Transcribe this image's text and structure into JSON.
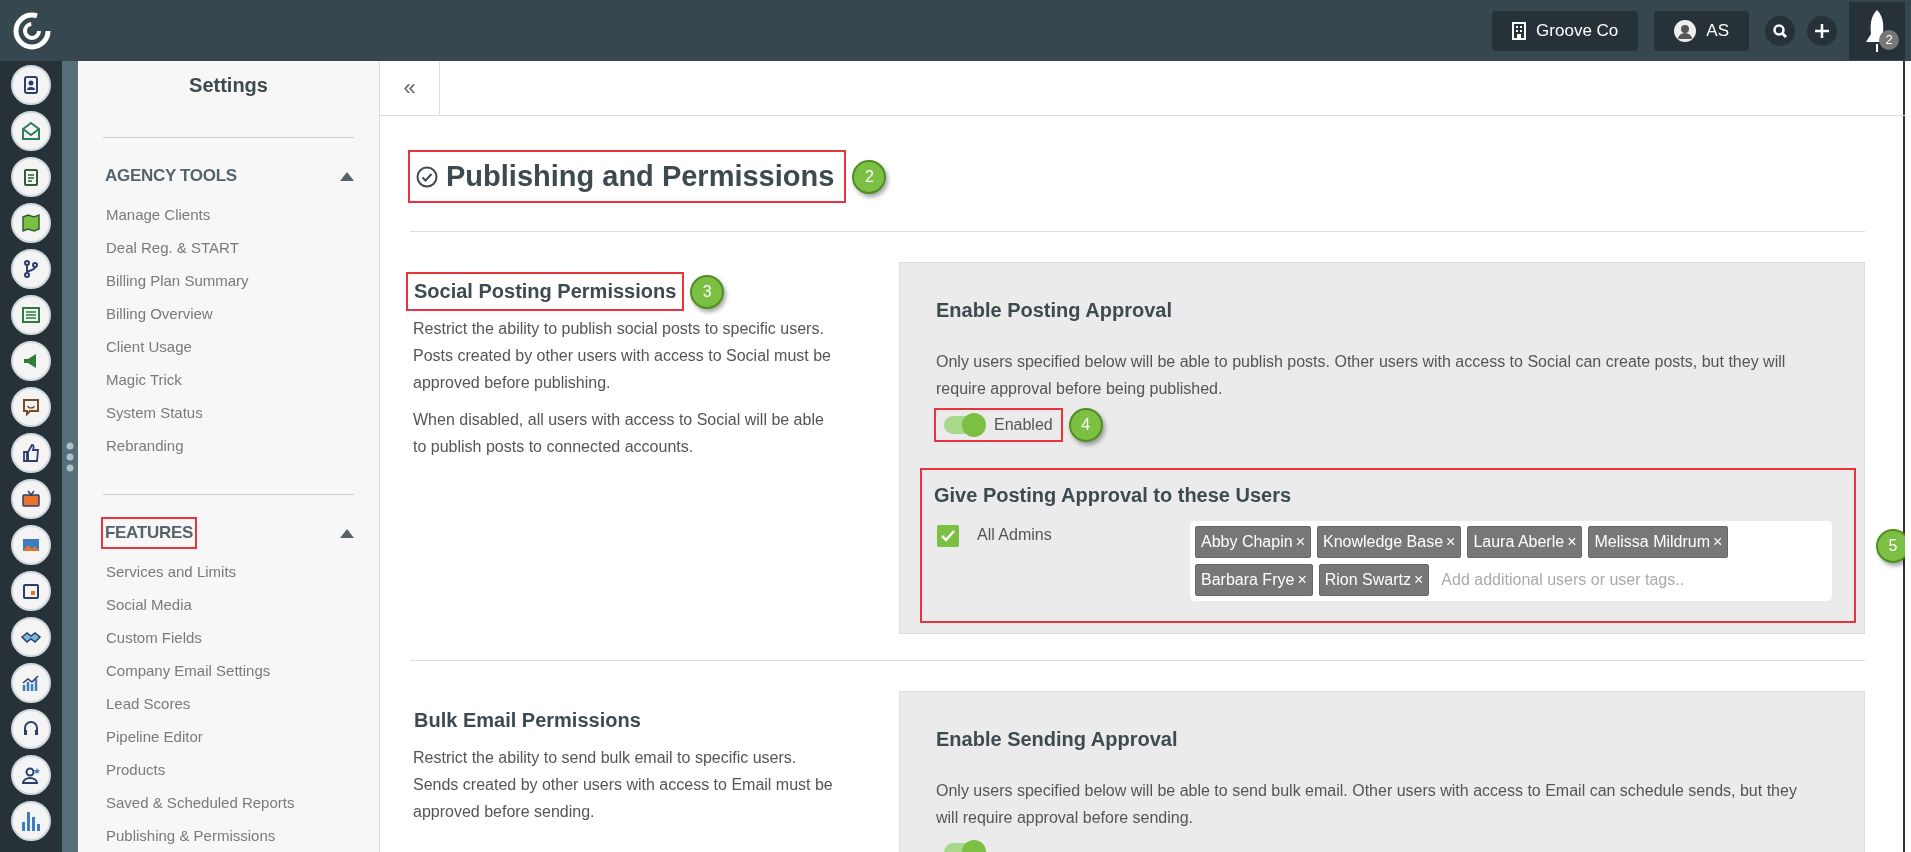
{
  "top_bar": {
    "company": "Groove Co",
    "user_initials": "AS",
    "notification_count": "2"
  },
  "sidebar": {
    "title": "Settings",
    "sections": [
      {
        "title": "AGENCY TOOLS",
        "expanded": true,
        "highlighted": false,
        "items": [
          "Manage Clients",
          "Deal Reg. & START",
          "Billing Plan Summary",
          "Billing Overview",
          "Client Usage",
          "Magic Trick",
          "System Status",
          "Rebranding"
        ]
      },
      {
        "title": "FEATURES",
        "expanded": true,
        "highlighted": true,
        "items": [
          "Services and Limits",
          "Social Media",
          "Custom Fields",
          "Company Email Settings",
          "Lead Scores",
          "Pipeline Editor",
          "Products",
          "Saved & Scheduled Reports",
          "Publishing & Permissions"
        ]
      }
    ]
  },
  "content": {
    "collapse_button": "«",
    "title": "Publishing and Permissions",
    "highlighted": true,
    "callout": "2",
    "sections": [
      {
        "title": "Social Posting Permissions",
        "highlighted": true,
        "callout": "3",
        "paragraphs": [
          "Restrict the ability to publish social posts to specific users. Posts created by other users with access to Social must be approved before publishing.",
          "When disabled, all users with access to Social will be able to publish posts to connected accounts."
        ],
        "panel": {
          "title": "Enable Posting Approval",
          "description": "Only users specified below will be able to publish posts. Other users with access to Social can create posts, but they will require approval before being published.",
          "toggle": {
            "label": "Enabled",
            "on": true,
            "highlighted": true,
            "callout": "4"
          },
          "users": {
            "title": "Give Posting Approval to these Users",
            "highlighted": true,
            "callout": "5",
            "checkbox": {
              "label": "All Admins",
              "checked": true
            },
            "tags": [
              {
                "name": "Abby Chapin",
                "remove": "×"
              },
              {
                "name": "Knowledge Base",
                "remove": "×"
              },
              {
                "name": "Laura Aberle",
                "remove": "×"
              },
              {
                "name": "Melissa Mildrum",
                "remove": "×"
              },
              {
                "name": "Barbara Frye",
                "remove": "×"
              },
              {
                "name": "Rion Swartz",
                "remove": "×"
              }
            ],
            "placeholder": "Add additional users or user tags.."
          }
        }
      },
      {
        "title": "Bulk Email Permissions",
        "highlighted": false,
        "paragraphs": [
          "Restrict the ability to send bulk email to specific users. Sends created by other users with access to Email must be approved before sending."
        ],
        "panel": {
          "title": "Enable Sending Approval",
          "description": "Only users specified below will be able to send bulk email. Other users with access to Email can schedule sends, but they will require approval before sending.",
          "toggle": {
            "on": true,
            "highlighted": false
          }
        }
      }
    ]
  }
}
